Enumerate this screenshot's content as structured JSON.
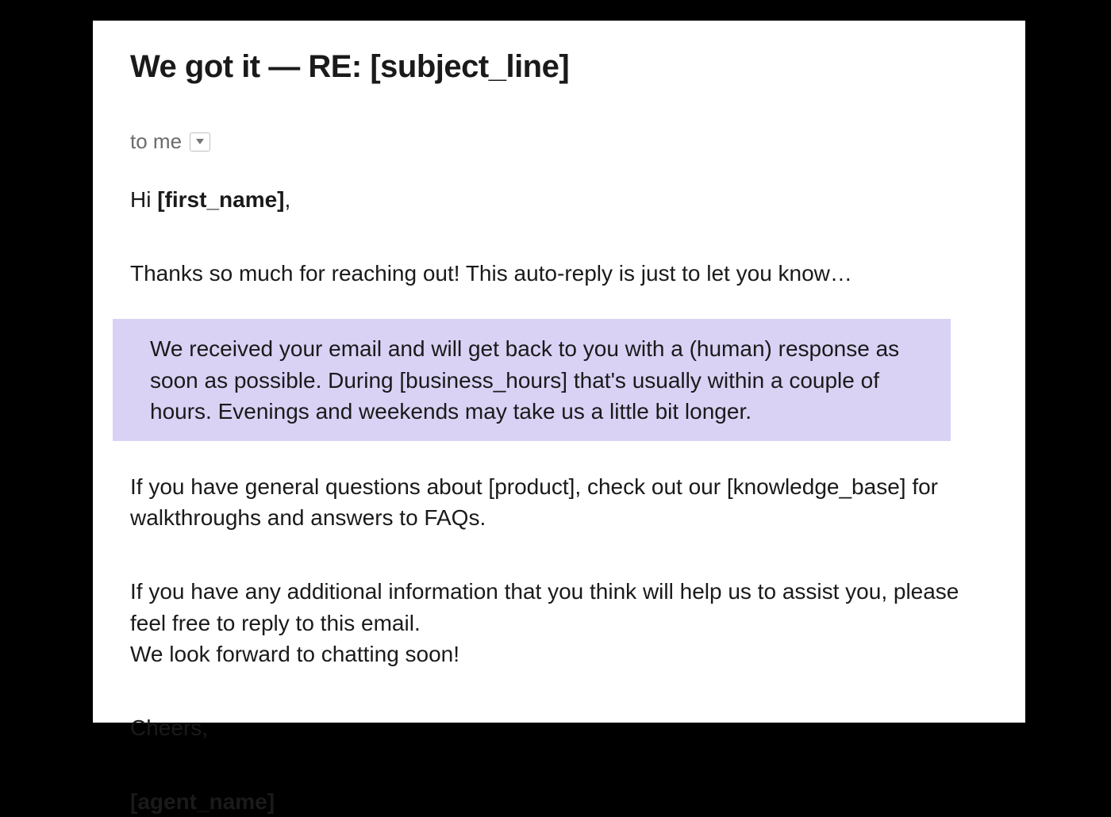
{
  "email": {
    "subject": "We got it — RE: [subject_line]",
    "recipient_label": "to me",
    "greeting_prefix": "Hi ",
    "greeting_name": "[first_name]",
    "greeting_suffix": ",",
    "paragraph_1": "Thanks so much for reaching out! This auto-reply is just to let you know…",
    "paragraph_2_highlighted": "We received your email and will get back to you with a (human) response as soon as possible. During [business_hours] that's usually within a couple of hours. Evenings and weekends may take us a little bit longer.",
    "paragraph_3": "If you have general questions about [product], check out our [knowledge_base] for walkthroughs and answers to FAQs.",
    "paragraph_4a": "If you have any additional information that you think will help us to assist you, please feel free to reply to this email.",
    "paragraph_4b": "We look forward to chatting soon!",
    "signoff": "Cheers,",
    "agent_name": "[agent_name]"
  }
}
